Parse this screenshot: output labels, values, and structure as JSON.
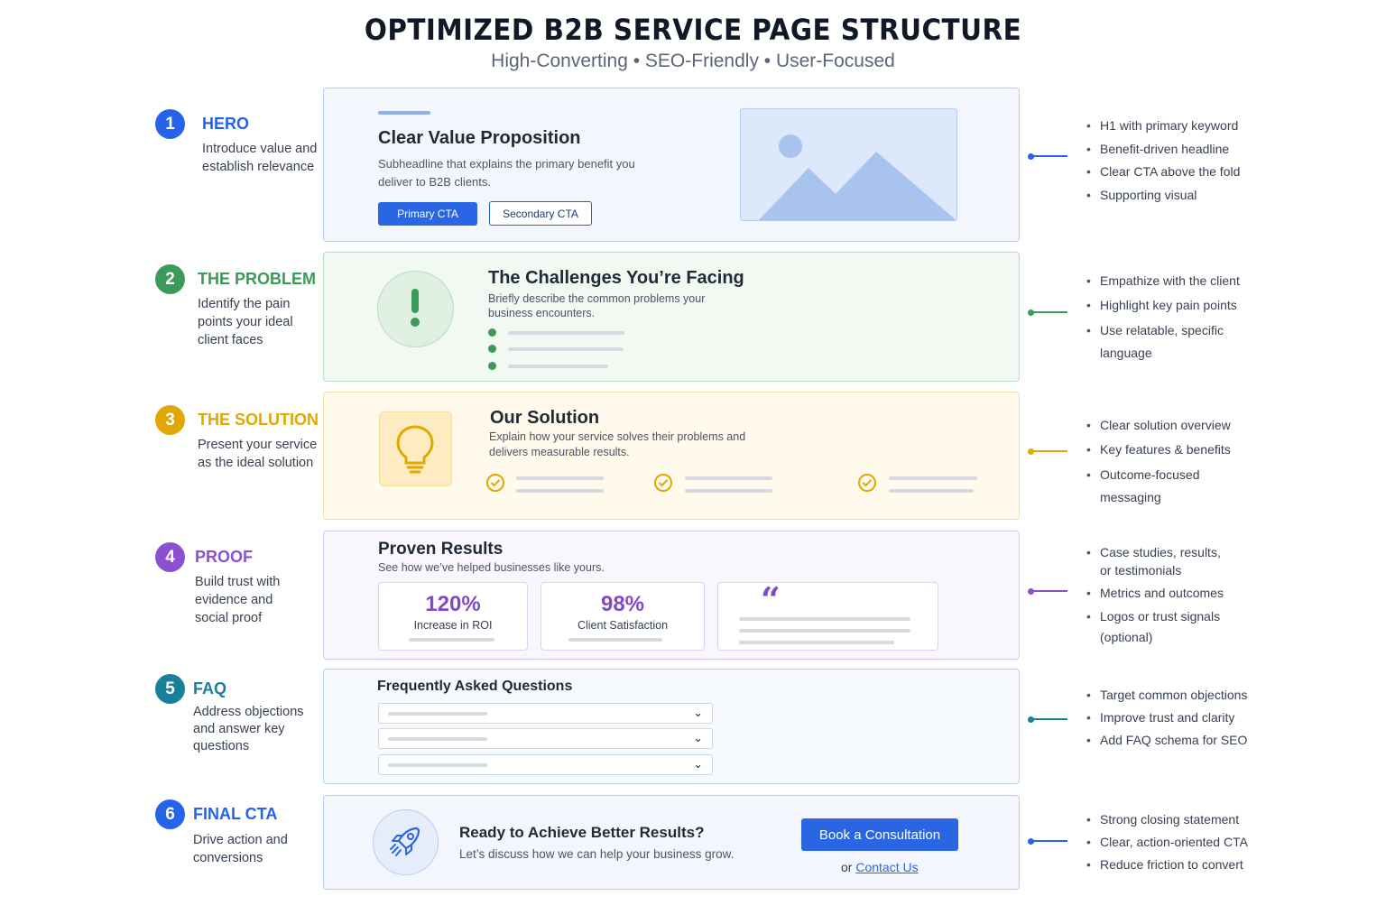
{
  "title": "OPTIMIZED B2B SERVICE PAGE STRUCTURE",
  "subtitle": "High-Converting • SEO-Friendly • User-Focused",
  "sections": [
    {
      "number": "1",
      "title": "HERO",
      "description": "Introduce value and establish relevance",
      "color": "#2563eb",
      "card": {
        "heading": "Clear Value Proposition",
        "subheading": "Subheadline that explains the primary benefit you deliver to B2B clients.",
        "primary_cta": "Primary CTA",
        "secondary_cta": "Secondary CTA",
        "visual_icon": "image-placeholder-icon"
      },
      "tips": [
        "H1 with primary keyword",
        "Benefit-driven headline",
        "Clear CTA above the fold",
        "Supporting visual"
      ]
    },
    {
      "number": "2",
      "title": "THE PROBLEM",
      "description": "Identify the pain points your ideal client faces",
      "color": "#3a9a57",
      "card": {
        "heading": "The Challenges You’re Facing",
        "subheading": "Briefly describe the common problems your business encounters.",
        "icon": "exclamation-icon"
      },
      "tips": [
        "Empathize with the client",
        "Highlight key pain points",
        "Use relatable, specific language"
      ]
    },
    {
      "number": "3",
      "title": "THE SOLUTION",
      "description": "Present your service as the ideal solution",
      "color": "#e0a800",
      "card": {
        "heading": "Our Solution",
        "subheading": "Explain how your service solves their problems and delivers measurable results.",
        "icon": "lightbulb-icon"
      },
      "tips": [
        "Clear solution overview",
        "Key features & benefits",
        "Outcome-focused messaging"
      ]
    },
    {
      "number": "4",
      "title": "PROOF",
      "description": "Build trust with evidence and social proof",
      "color": "#8b4fd1",
      "card": {
        "heading": "Proven Results",
        "subheading": "See how we’ve helped businesses like yours.",
        "stats": [
          {
            "value": "120%",
            "label": "Increase in ROI"
          },
          {
            "value": "98%",
            "label": "Client Satisfaction"
          }
        ],
        "quote_mark": "“"
      },
      "tips": [
        "Case studies, results, or testimonials",
        "Metrics and outcomes",
        "Logos or trust signals (optional)"
      ]
    },
    {
      "number": "5",
      "title": "FAQ",
      "description": "Address objections and answer key questions",
      "color": "#1a7f9a",
      "card": {
        "heading": "Frequently Asked Questions"
      },
      "tips": [
        "Target common objections",
        "Improve trust and clarity",
        "Add FAQ schema for SEO"
      ]
    },
    {
      "number": "6",
      "title": "FINAL CTA",
      "description": "Drive action and conversions",
      "color": "#2563eb",
      "card": {
        "heading": "Ready to Achieve Better Results?",
        "subheading": "Let’s discuss how we can help your business grow.",
        "button": "Book a Consultation",
        "contact_prefix": "or",
        "contact_link": "Contact Us",
        "icon": "rocket-icon"
      },
      "tips": [
        "Strong closing statement",
        "Clear, action-oriented CTA",
        "Reduce friction to convert"
      ]
    }
  ]
}
